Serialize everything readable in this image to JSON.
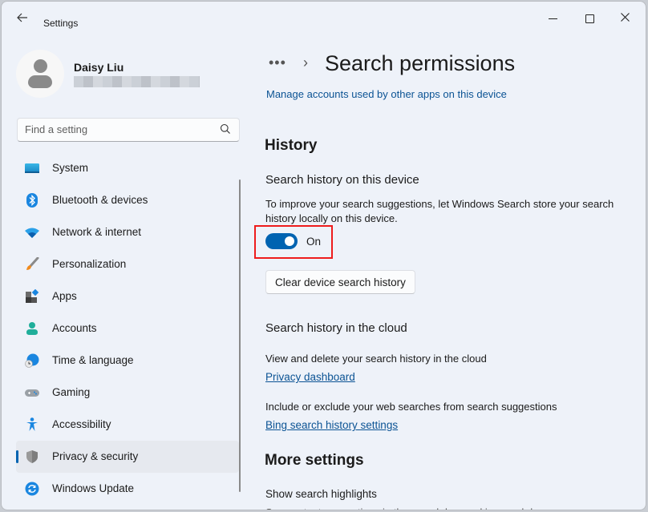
{
  "window": {
    "title": "Settings",
    "controls": {
      "minimize": "minimize",
      "maximize": "maximize",
      "close": "close"
    }
  },
  "user": {
    "name": "Daisy Liu",
    "email_redacted": true
  },
  "search": {
    "placeholder": "Find a setting",
    "value": ""
  },
  "sidebar": {
    "items": [
      {
        "label": "System",
        "icon": "system-icon",
        "selected": false
      },
      {
        "label": "Bluetooth & devices",
        "icon": "bluetooth-icon",
        "selected": false
      },
      {
        "label": "Network & internet",
        "icon": "wifi-icon",
        "selected": false
      },
      {
        "label": "Personalization",
        "icon": "brush-icon",
        "selected": false
      },
      {
        "label": "Apps",
        "icon": "apps-icon",
        "selected": false
      },
      {
        "label": "Accounts",
        "icon": "account-icon",
        "selected": false
      },
      {
        "label": "Time & language",
        "icon": "globe-clock-icon",
        "selected": false
      },
      {
        "label": "Gaming",
        "icon": "gamepad-icon",
        "selected": false
      },
      {
        "label": "Accessibility",
        "icon": "accessibility-icon",
        "selected": false
      },
      {
        "label": "Privacy & security",
        "icon": "shield-icon",
        "selected": true
      },
      {
        "label": "Windows Update",
        "icon": "update-icon",
        "selected": false
      }
    ]
  },
  "main": {
    "breadcrumb_more": "•••",
    "breadcrumb_separator": "›",
    "title": "Search permissions",
    "manage_link": "Manage accounts used by other apps on this device",
    "history": {
      "heading": "History",
      "device": {
        "title": "Search history on this device",
        "description": "To improve your search suggestions, let Windows Search store your search history locally on this device.",
        "toggle_state": "On",
        "toggle_on": true,
        "clear_button": "Clear device search history"
      },
      "cloud": {
        "title": "Search history in the cloud",
        "view_desc": "View and delete your search history in the cloud",
        "privacy_link": "Privacy dashboard",
        "include_desc": "Include or exclude your web searches from search suggestions",
        "bing_link": "Bing search history settings"
      }
    },
    "more_settings": {
      "heading": "More settings",
      "highlights_title": "Show search highlights",
      "highlights_desc_partial": "See content suggestions in the search box and in search home"
    }
  },
  "colors": {
    "accent": "#0063b1",
    "link": "#0b5394",
    "highlight_box": "#ee1c1c",
    "background": "#eef2f9"
  }
}
